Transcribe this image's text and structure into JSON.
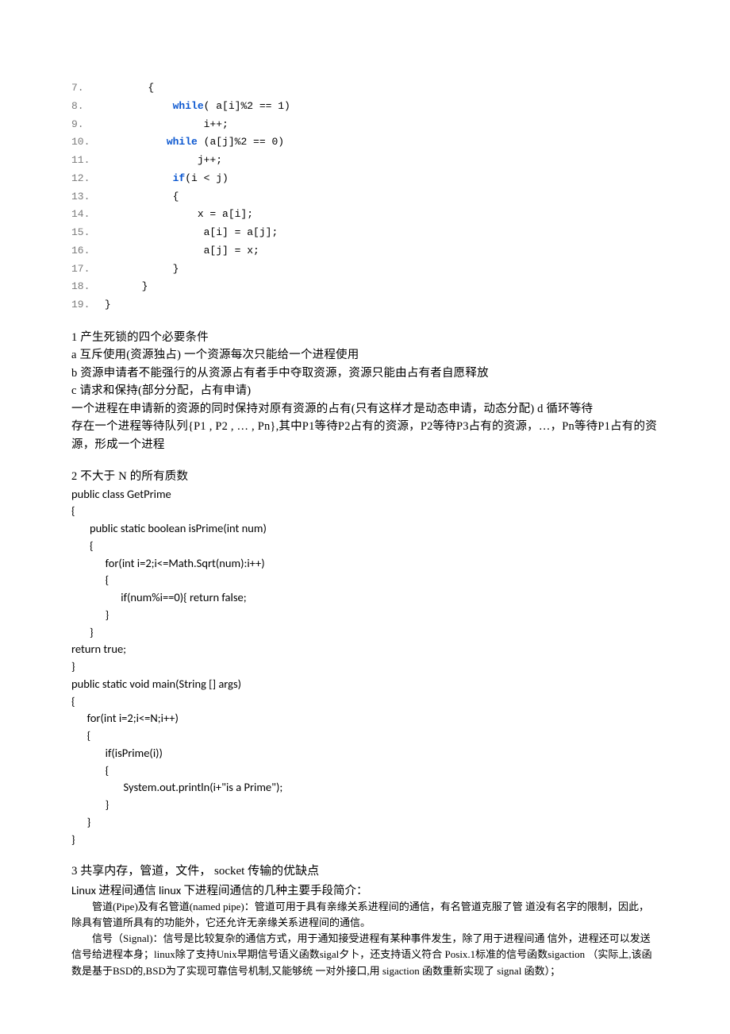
{
  "code1": {
    "lines": [
      {
        "n": "7.",
        "indent": "        ",
        "tokens": [
          {
            "t": "{"
          }
        ]
      },
      {
        "n": "8.",
        "indent": "            ",
        "tokens": [
          {
            "t": "while",
            "cls": "kw"
          },
          {
            "t": "( a[i]%2 == 1)"
          }
        ]
      },
      {
        "n": "9.",
        "indent": "                 ",
        "tokens": [
          {
            "t": "i++;"
          }
        ]
      },
      {
        "n": "10.",
        "indent": "           ",
        "tokens": [
          {
            "t": "while",
            "cls": "kw"
          },
          {
            "t": " (a[j]%2 == 0)"
          }
        ]
      },
      {
        "n": "11.",
        "indent": "                ",
        "tokens": [
          {
            "t": "j++;"
          }
        ]
      },
      {
        "n": "12.",
        "indent": "            ",
        "tokens": [
          {
            "t": "if",
            "cls": "kw2"
          },
          {
            "t": "(i < j)"
          }
        ]
      },
      {
        "n": "13.",
        "indent": "            ",
        "tokens": [
          {
            "t": "{"
          }
        ]
      },
      {
        "n": "14.",
        "indent": "                ",
        "tokens": [
          {
            "t": "x = a[i];"
          }
        ]
      },
      {
        "n": "15.",
        "indent": "                 ",
        "tokens": [
          {
            "t": "a[i] = a[j];"
          }
        ]
      },
      {
        "n": "16.",
        "indent": "                 ",
        "tokens": [
          {
            "t": "a[j] = x;"
          }
        ]
      },
      {
        "n": "17.",
        "indent": "            ",
        "tokens": [
          {
            "t": "}"
          }
        ]
      },
      {
        "n": "18.",
        "indent": "       ",
        "tokens": [
          {
            "t": "}"
          }
        ]
      },
      {
        "n": "19.",
        "indent": " ",
        "tokens": [
          {
            "t": "}"
          }
        ]
      }
    ]
  },
  "deadlock": {
    "title": "1 产生死锁的四个必要条件",
    "a": "a 互斥使用(资源独占) 一个资源每次只能给一个进程使用",
    "b": "b 资源申请者不能强行的从资源占有者手中夺取资源，资源只能由占有者自愿释放",
    "c": "c 请求和保持(部分分配，占有申请)",
    "c2": "一个进程在申请新的资源的同时保持对原有资源的占有(只有这样才是动态申请，动态分配)  d 循环等待",
    "d": "存在一个进程等待队列{P1 , P2 , … , Pn},其中P1等待P2占有的资源，P2等待P3占有的资源，…，Pn等待P1占有的资源，形成一个进程"
  },
  "prime": {
    "title": "2 不大于 N 的所有质数",
    "code": "public class GetPrime\n{\n       public static boolean isPrime(int num)\n       {\n             for(int i=2;i<=Math.Sqrt(num):i++)\n             {\n                   if(num%i==0){ return false;\n             }\n       }\nreturn true;\n}\npublic static void main(String [] args)\n{\n      for(int i=2;i<=N;i++)\n      {\n             if(isPrime(i))\n             {\n                    System.out.println(i+\"is a Prime\");\n             }\n      }\n}"
  },
  "ipc": {
    "title": "3 共享内存，管道，文件， socket 传输的优缺点",
    "intro": "Linux 进程间通信 linux 下进程间通信的几种主要手段简介：",
    "p1": "管道(Pipe)及有名管道(named pipe)：管道可用于具有亲缘关系进程间的通信，有名管道克服了管 道没有名字的限制，因此，除具有管道所具有的功能外，它还允许无亲缘关系进程间的通信。",
    "p2": "信号（Signal)：信号是比较复杂的通信方式，用于通知接受进程有某种事件发生，除了用于进程间通 信外，进程还可以发送信号给进程本身；linux除了支持Unix早期信号语义函数sigal夕卜，还支持语义符合 Posix.1标准的信号函数sigaction （实际上,该函数是基于BSD的,BSD为了实现可靠信号机制,又能够统 一对外接口,用 sigaction 函数重新实现了 signal 函数）；"
  }
}
